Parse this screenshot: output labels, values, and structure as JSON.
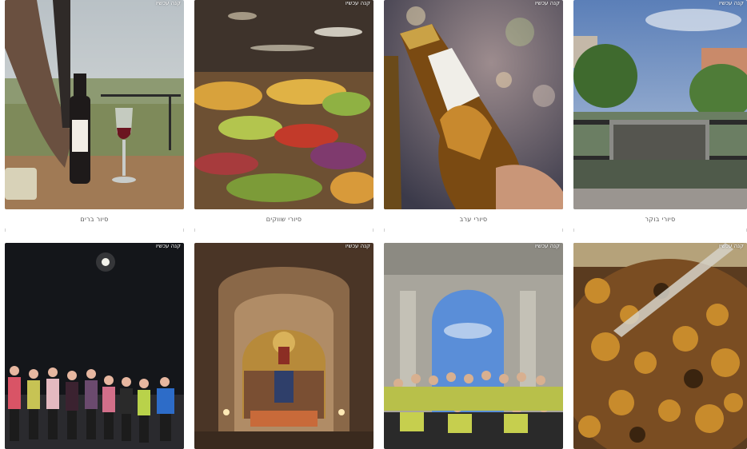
{
  "colors": {
    "background": "#ffffff",
    "title_text": "#555555",
    "badge_text": "#ffffff"
  },
  "tours": [
    {
      "title": "סיור ברים",
      "badge": "קנה עכשיו",
      "photo": "wine-bottle-glass-vineyard-photo"
    },
    {
      "title": "סיורי שווקים",
      "badge": "קנה עכשיו",
      "photo": "market-produce-stall-photo"
    },
    {
      "title": "סיורי ערב",
      "badge": "קנה עכשיו",
      "photo": "beer-bottle-evening-photo"
    },
    {
      "title": "סיורי בוקר",
      "badge": "קנה עכשיו",
      "photo": "city-street-trees-photo"
    },
    {
      "title": "",
      "badge": "קנה עכשיו",
      "photo": "night-runners-group-photo"
    },
    {
      "title": "",
      "badge": "קנה עכשיו",
      "photo": "church-interior-mosaic-photo"
    },
    {
      "title": "",
      "badge": "קנה עכשיו",
      "photo": "arch-group-runners-photo"
    },
    {
      "title": "",
      "badge": "קנה עכשיו",
      "photo": "stew-pot-cooking-photo"
    }
  ]
}
